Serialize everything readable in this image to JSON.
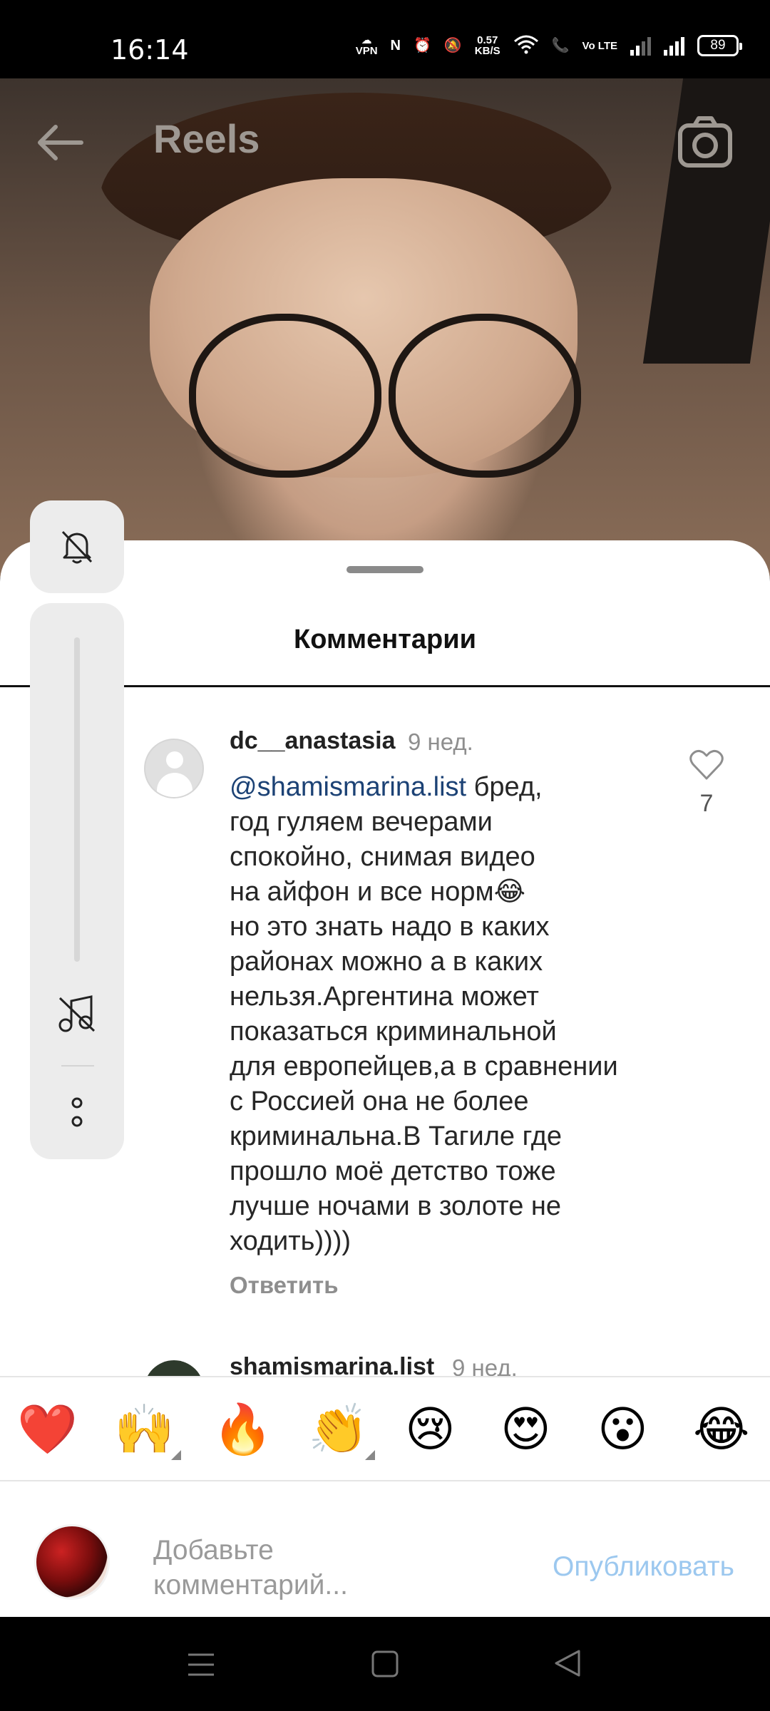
{
  "status_bar": {
    "time": "16:14",
    "vpn": "VPN",
    "speed_value": "0.57",
    "speed_unit": "KB/S",
    "volte": "Vo LTE",
    "battery": "89"
  },
  "header": {
    "title": "Reels"
  },
  "comments_sheet": {
    "title": "Комментарии",
    "comments": [
      {
        "username": "dc__anastasia",
        "time": "9 нед.",
        "mention": "@shamismarina.list",
        "text": " бред,\nгод гуляем вечерами\nспокойно, снимая видео\nна айфон и все норм😂\nно это знать надо в каких\nрайонах можно а в каких\nнельзя.Аргентина может\nпоказаться криминальной\nдля европейцев,а в сравнении\nс Россией она не более\nкриминальна.В Тагиле где\nпрошло моё детство тоже\nлучше ночами в золоте не\nходить))))",
        "reply_label": "Ответить",
        "likes": "7"
      },
      {
        "username": "shamismarina.list",
        "time": "9 нед."
      }
    ]
  },
  "emoji_bar": [
    "❤️",
    "🙌",
    "🔥",
    "👏",
    "😢",
    "😍",
    "😮",
    "😂"
  ],
  "compose": {
    "placeholder": "Добавьте\nкомментарий...",
    "publish_label": "Опубликовать"
  },
  "colors": {
    "accent_link": "#1c4275",
    "publish_disabled": "#9cc8ef"
  }
}
